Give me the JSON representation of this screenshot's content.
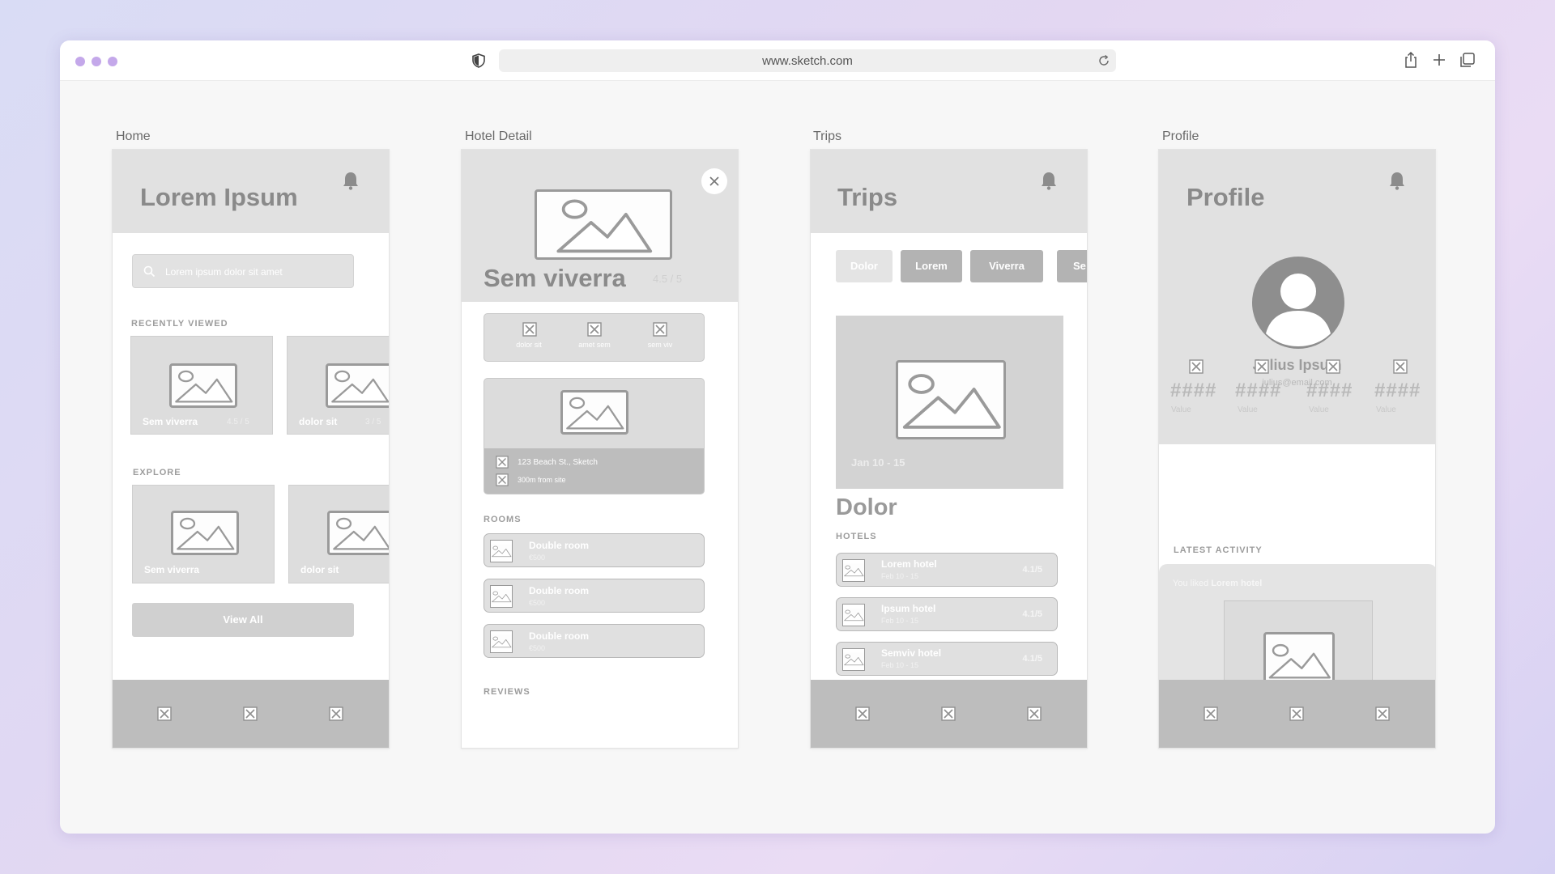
{
  "browser": {
    "url": "www.sketch.com",
    "icons": [
      "shield-icon",
      "reload-icon",
      "share-icon",
      "plus-icon",
      "tabs-icon"
    ]
  },
  "screens": {
    "home": {
      "label": "Home",
      "title": "Lorem Ipsum",
      "search_placeholder": "Lorem ipsum dolor sit amet",
      "recently_viewed_label": "RECENTLY VIEWED",
      "recently_viewed": [
        {
          "title": "Sem viverra",
          "rating": "4.5 / 5"
        },
        {
          "title": "dolor sit",
          "rating": "3 / 5"
        }
      ],
      "explore_label": "EXPLORE",
      "explore": [
        {
          "title": "Sem viverra"
        },
        {
          "title": "dolor sit"
        }
      ],
      "view_all": "View All"
    },
    "hotel_detail": {
      "label": "Hotel Detail",
      "title": "Sem viverra",
      "rating": "4.5 / 5",
      "amenities": [
        "dolor sit",
        "amet sem",
        "sem viv"
      ],
      "address": "123 Beach St., Sketch",
      "distance": "300m from site",
      "rooms_label": "ROOMS",
      "rooms": [
        {
          "name": "Double room",
          "price": "€500"
        },
        {
          "name": "Double room",
          "price": "€500"
        },
        {
          "name": "Double room",
          "price": "€500"
        }
      ],
      "reviews_label": "REVIEWS"
    },
    "trips": {
      "label": "Trips",
      "title": "Trips",
      "chips": [
        "Dolor",
        "Lorem",
        "Viverra",
        "Se"
      ],
      "trip_dates": "Jan 10 - 15",
      "trip_title": "Dolor",
      "hotels_label": "HOTELS",
      "hotels": [
        {
          "name": "Lorem hotel",
          "dates": "Feb 10 - 15",
          "rating": "4.1/5"
        },
        {
          "name": "Ipsum hotel",
          "dates": "Feb 10 - 15",
          "rating": "4.1/5"
        },
        {
          "name": "Semviv hotel",
          "dates": "Feb 10 - 15",
          "rating": "4.1/5"
        }
      ]
    },
    "profile": {
      "label": "Profile",
      "title": "Profile",
      "name": "Julius Ipsum",
      "email": "julius@email.com",
      "stats": [
        {
          "value": "####",
          "label": "Value"
        },
        {
          "value": "####",
          "label": "Value"
        },
        {
          "value": "####",
          "label": "Value"
        },
        {
          "value": "####",
          "label": "Value"
        }
      ],
      "latest_activity_label": "LATEST ACTIVITY",
      "activity_prefix": "You liked",
      "activity_item": "Lorem hotel"
    }
  },
  "colors": {
    "dots": "#c4a8ea",
    "header_grey": "#e1e1e1",
    "tabbar_grey": "#bdbdbd"
  }
}
